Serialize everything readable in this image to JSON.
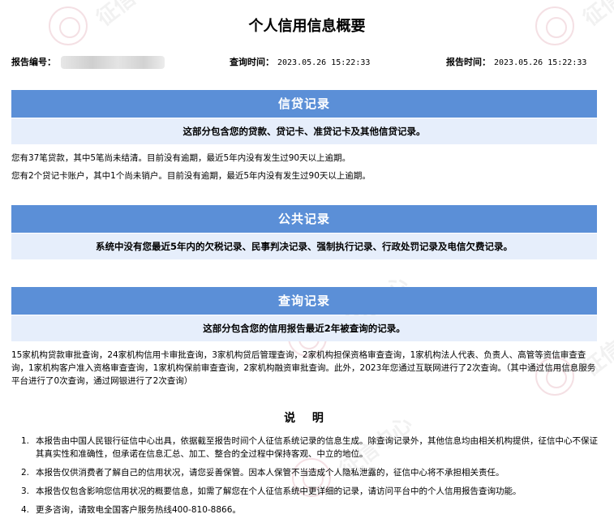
{
  "title": "个人信用信息概要",
  "report_no": {
    "label": "报告编号："
  },
  "query_time": {
    "label": "查询时间：",
    "value": "2023.05.26  15:22:33"
  },
  "report_time": {
    "label": "报告时间：",
    "value": "2023.05.26  15:22:33"
  },
  "credit": {
    "header": "信贷记录",
    "subheader": "这部分包含您的贷款、贷记卡、准贷记卡及其他信贷记录。",
    "lines": [
      "您有37笔贷款，其中5笔尚未结清。目前没有逾期，最近5年内没有发生过90天以上逾期。",
      "您有2个贷记卡账户，其中1个尚未销户。目前没有逾期，最近5年内没有发生过90天以上逾期。"
    ]
  },
  "public": {
    "header": "公共记录",
    "subheader": "系统中没有您最近5年内的欠税记录、民事判决记录、强制执行记录、行政处罚记录及电信欠费记录。"
  },
  "inquiry": {
    "header": "查询记录",
    "subheader": "这部分包含您的信用报告最近2年被查询的记录。",
    "paragraph": "15家机构贷款审批查询，24家机构信用卡审批查询，3家机构贷后管理查询，2家机构担保资格审查查询，1家机构法人代表、负责人、高管等资信审查查询，1家机构客户准入资格审查查询，1家机构保前审查查询，2家机构融资审批查询。此外，2023年您通过互联网进行了2次查询。（其中通过信用信息服务平台进行了0次查询，通过网银进行了2次查询）"
  },
  "notes": {
    "title": "说 明",
    "items": [
      {
        "num": "1.",
        "text": "本报告由中国人民银行征信中心出具，依据截至报告时间个人征信系统记录的信息生成。除查询记录外，其他信息均由相关机构提供，征信中心不保证其真实性和准确性，但承诺在信息汇总、加工、整合的全过程中保持客观、中立的地位。"
      },
      {
        "num": "2.",
        "text": "本报告仅供消费者了解自己的信用状况，请您妥善保管。因本人保管不当造成个人隐私泄露的，征信中心将不承担相关责任。"
      },
      {
        "num": "3.",
        "text": "本报告仅包含影响您信用状况的概要信息，如需了解您在个人征信系统中更详细的记录，请访问平台中的个人信用报告查询功能。"
      },
      {
        "num": "4.",
        "text": "更多咨询，请致电全国客户服务热线400-810-8866。"
      }
    ]
  },
  "watermark": {
    "text": "征信中心"
  }
}
